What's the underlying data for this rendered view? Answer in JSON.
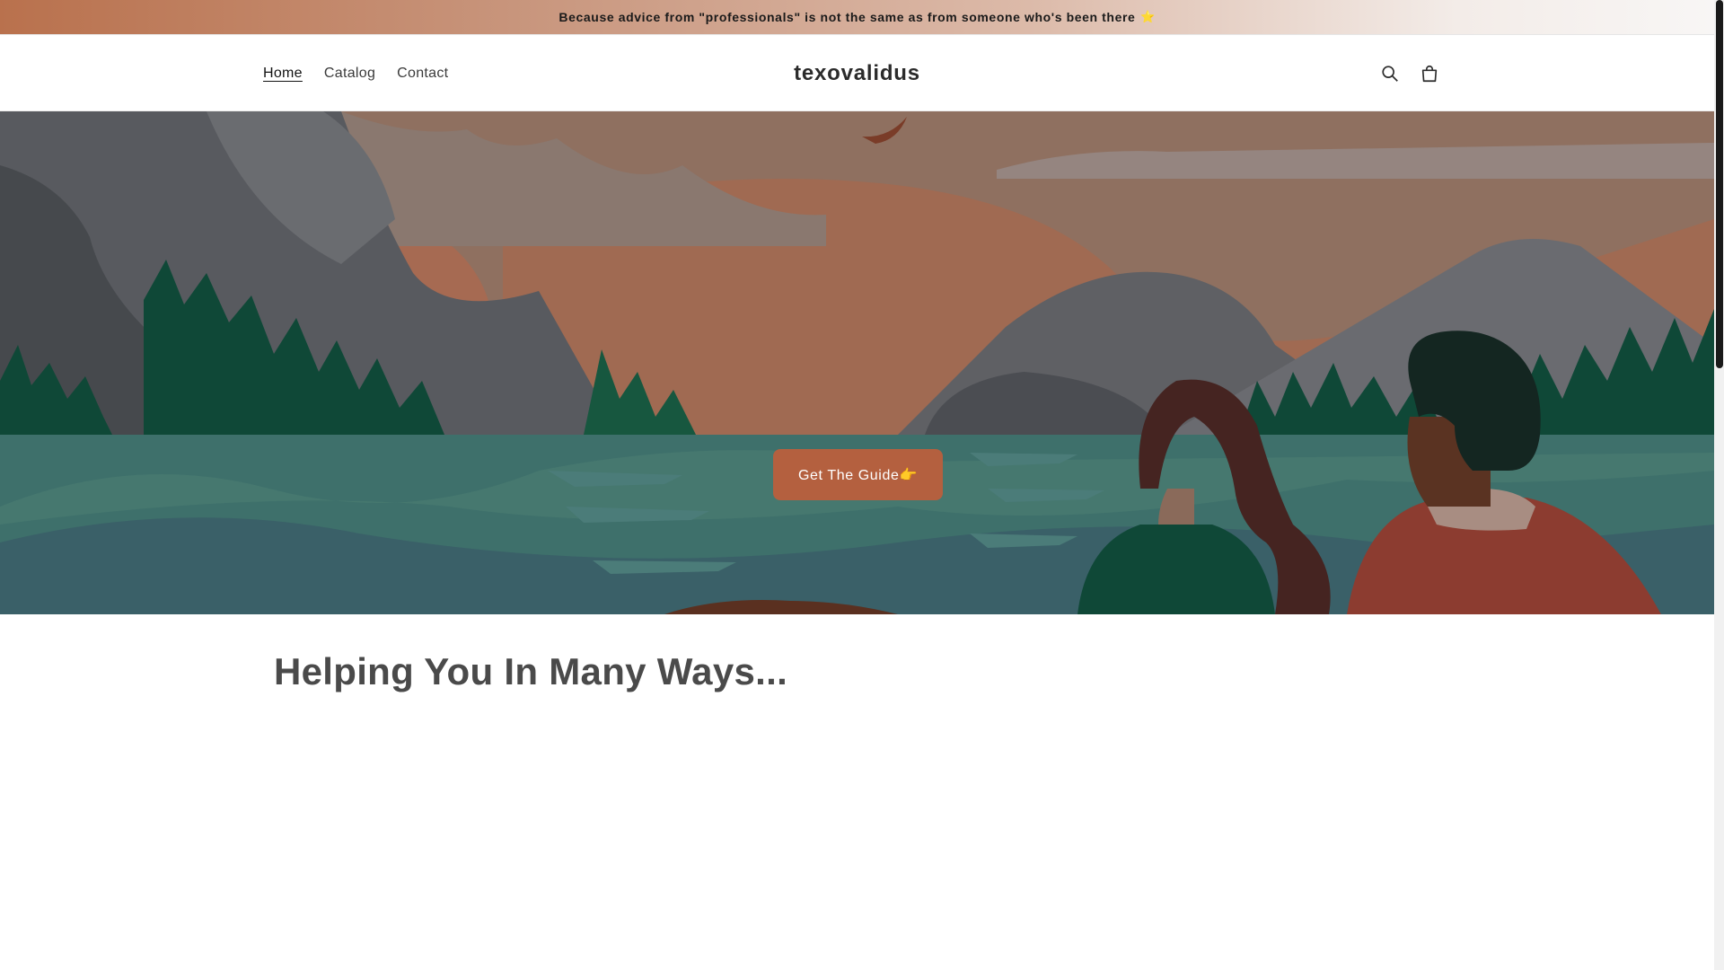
{
  "announcement": {
    "text": "Because advice from \"professionals\" is not the same as from someone who's been there",
    "emoji": "⭐"
  },
  "header": {
    "nav": [
      {
        "label": "Home",
        "active": true
      },
      {
        "label": "Catalog",
        "active": false
      },
      {
        "label": "Contact",
        "active": false
      }
    ],
    "brand": "texovalidus",
    "icons": [
      "search-icon",
      "cart-icon"
    ]
  },
  "hero": {
    "cta_label": "Get The Guide👉"
  },
  "section": {
    "heading": "Helping You In Many Ways..."
  },
  "colors": {
    "accent": "#b4603f",
    "sky": "#8f7060",
    "water": "#3e706b",
    "forest": "#0f4837"
  }
}
